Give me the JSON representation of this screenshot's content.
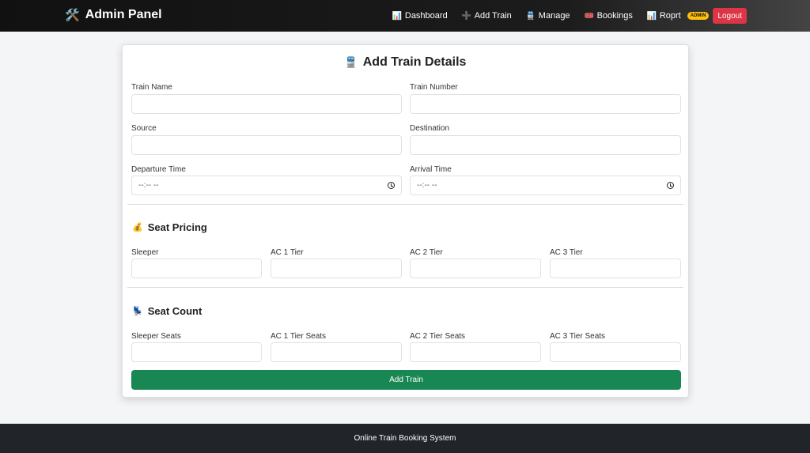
{
  "nav": {
    "brand_icon": "🛠️",
    "brand": "Admin Panel",
    "items": [
      {
        "icon": "📊",
        "label": "Dashboard"
      },
      {
        "icon": "➕",
        "label": "Add Train"
      },
      {
        "icon": "🚆",
        "label": "Manage"
      },
      {
        "icon": "🎟️",
        "label": "Bookings"
      },
      {
        "icon": "📊",
        "label": "Roprt"
      }
    ],
    "badge": "ADMIN",
    "logout": "Logout"
  },
  "form": {
    "title_icon": "🚆",
    "title": "Add Train Details",
    "train_name_label": "Train Name",
    "train_number_label": "Train Number",
    "source_label": "Source",
    "destination_label": "Destination",
    "departure_label": "Departure Time",
    "arrival_label": "Arrival Time",
    "time_placeholder": "--:-- --",
    "pricing_icon": "💰",
    "pricing_title": "Seat Pricing",
    "pricing_labels": [
      "Sleeper",
      "AC 1 Tier",
      "AC 2 Tier",
      "AC 3 Tier"
    ],
    "count_icon": "💺",
    "count_title": "Seat Count",
    "count_labels": [
      "Sleeper Seats",
      "AC 1 Tier Seats",
      "AC 2 Tier Seats",
      "AC 3 Tier Seats"
    ],
    "submit": "Add Train"
  },
  "footer": {
    "text": "Online Train Booking System"
  }
}
